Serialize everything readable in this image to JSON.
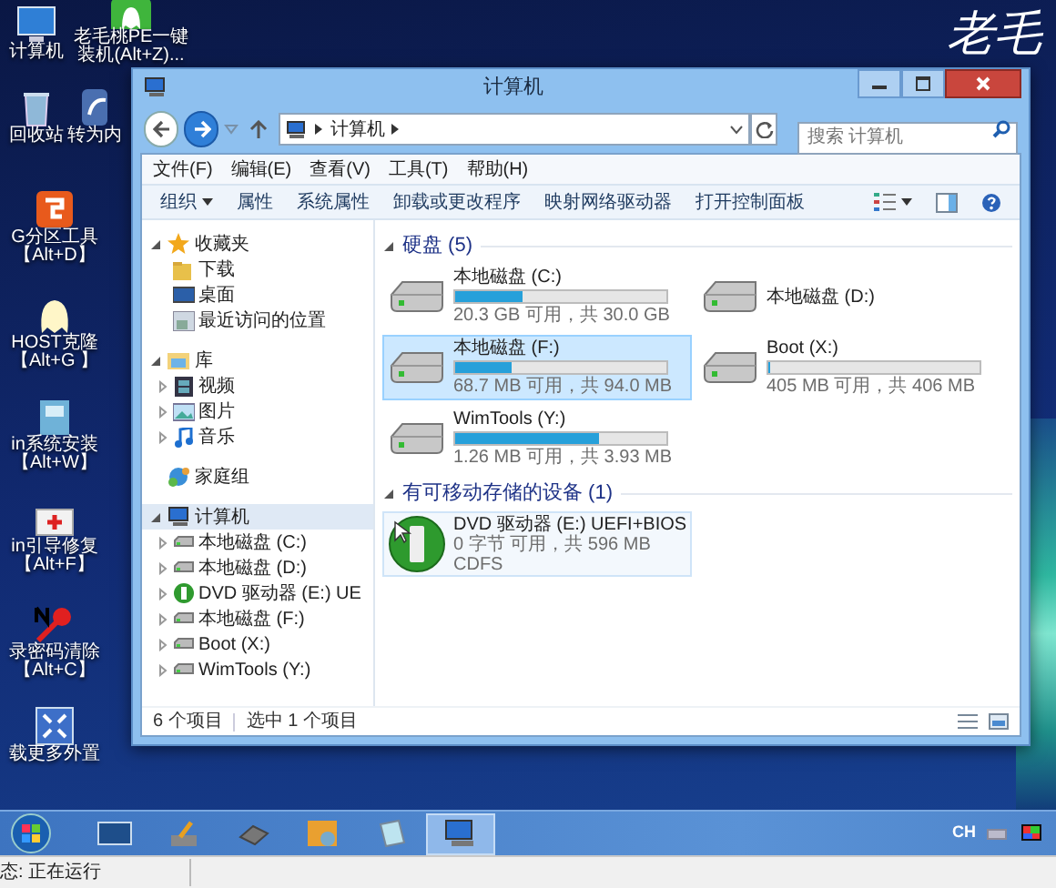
{
  "desktop": {
    "icons": [
      {
        "lines": [
          "计算机"
        ]
      },
      {
        "lines": [
          "回收站"
        ]
      },
      {
        "lines": [
          "G分区工具",
          "【Alt+D】"
        ]
      },
      {
        "lines": [
          "HOST克隆",
          "【Alt+G 】"
        ]
      },
      {
        "lines": [
          "in系统安装",
          "【Alt+W】"
        ]
      },
      {
        "lines": [
          "in引导修复",
          "【Alt+F】"
        ]
      },
      {
        "lines": [
          "录密码清除",
          "【Alt+C】"
        ]
      },
      {
        "lines": [
          "载更多外置"
        ]
      },
      {
        "lines": [
          "老毛桃PE一键",
          "装机(Alt+Z)..."
        ]
      },
      {
        "lines": [
          "转为内"
        ]
      }
    ],
    "wallpaper_logo": "老毛"
  },
  "window": {
    "title": "计算机",
    "address_path": [
      "计算机"
    ],
    "search": {
      "placeholder": "搜索 计算机"
    },
    "menu": [
      "文件(F)",
      "编辑(E)",
      "查看(V)",
      "工具(T)",
      "帮助(H)"
    ],
    "toolbar": [
      {
        "label": "组织",
        "dropdown": true
      },
      {
        "label": "属性",
        "dropdown": false
      },
      {
        "label": "系统属性",
        "dropdown": false
      },
      {
        "label": "卸载或更改程序",
        "dropdown": false
      },
      {
        "label": "映射网络驱动器",
        "dropdown": false
      },
      {
        "label": "打开控制面板",
        "dropdown": false
      }
    ],
    "nav_tree": [
      {
        "label": "收藏夹",
        "expanded": true,
        "selected": false,
        "children": [
          {
            "label": "下载"
          },
          {
            "label": "桌面"
          },
          {
            "label": "最近访问的位置"
          }
        ]
      },
      {
        "label": "库",
        "expanded": true,
        "selected": false,
        "children": [
          {
            "label": "视频",
            "expanded": false
          },
          {
            "label": "图片",
            "expanded": false
          },
          {
            "label": "音乐",
            "expanded": false
          }
        ]
      },
      {
        "label": "家庭组",
        "selected": false
      },
      {
        "label": "计算机",
        "expanded": true,
        "selected": true,
        "children": [
          {
            "label": "本地磁盘 (C:)",
            "kind": "disk",
            "expanded": false
          },
          {
            "label": "本地磁盘 (D:)",
            "kind": "disk",
            "expanded": false
          },
          {
            "label": "DVD 驱动器 (E:) UE",
            "kind": "dvd",
            "expanded": false
          },
          {
            "label": "本地磁盘 (F:)",
            "kind": "disk",
            "expanded": false
          },
          {
            "label": "Boot (X:)",
            "kind": "disk",
            "expanded": false
          },
          {
            "label": "WimTools (Y:)",
            "kind": "disk",
            "expanded": false
          }
        ]
      }
    ],
    "groups": [
      {
        "title": "硬盘 (5)",
        "expanded": true,
        "items": [
          {
            "kind": "disk",
            "name": "本地磁盘 (C:)",
            "level": 0.32,
            "free": "20.3 GB 可用，共 30.0 GB",
            "selected": false
          },
          {
            "kind": "disk",
            "name": "本地磁盘 (D:)",
            "selected": false
          },
          {
            "kind": "disk",
            "name": "本地磁盘 (F:)",
            "level": 0.27,
            "free": "68.7 MB 可用，共 94.0 MB",
            "selected": true
          },
          {
            "kind": "disk",
            "name": "Boot (X:)",
            "level": 0.003,
            "free": "405 MB 可用，共 406 MB",
            "selected": false
          },
          {
            "kind": "disk",
            "name": "WimTools (Y:)",
            "level": 0.68,
            "free": "1.26 MB 可用，共 3.93 MB",
            "selected": false
          }
        ]
      },
      {
        "title": "有可移动存储的设备 (1)",
        "expanded": true,
        "items": [
          {
            "kind": "dvd",
            "name": "DVD 驱动器 (E:) UEFI+BIOS",
            "free": "0 字节 可用，共 596 MB",
            "filesystem": "CDFS",
            "selected": false
          }
        ]
      }
    ],
    "status_bar": [
      "6 个项目",
      "选中 1 个项目"
    ]
  },
  "taskbar": {
    "items": [
      {
        "selected": false
      },
      {
        "selected": false
      },
      {
        "selected": false
      },
      {
        "selected": false
      },
      {
        "selected": false
      },
      {
        "selected": true
      }
    ],
    "tray_language": "CH"
  },
  "status_strip": "态: 正在运行"
}
